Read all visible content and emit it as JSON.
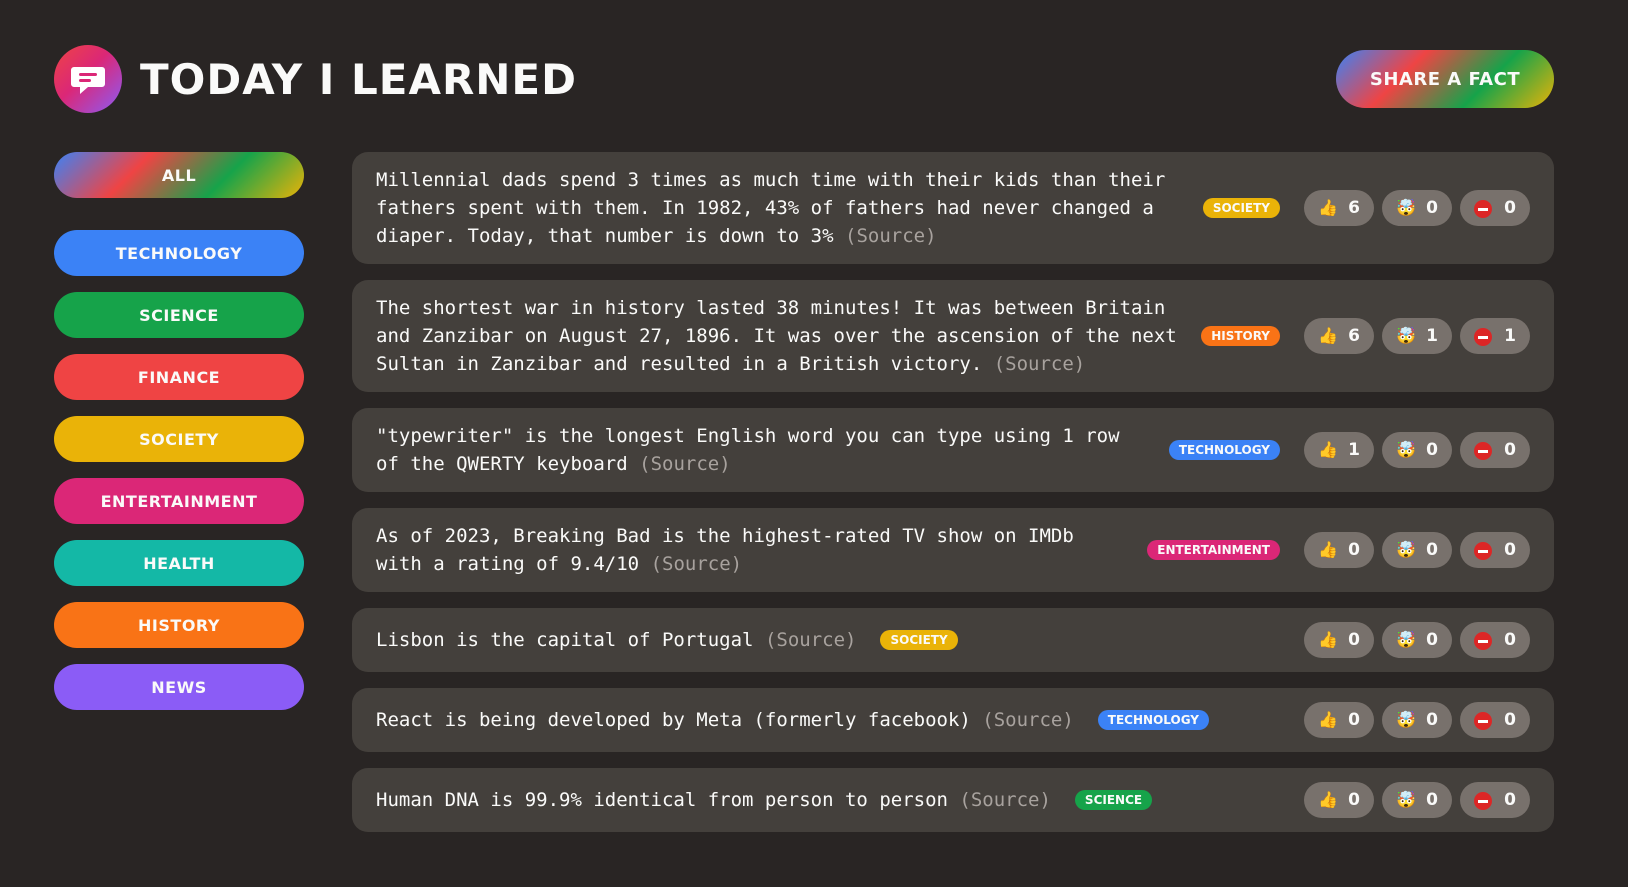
{
  "header": {
    "title": "Today I Learned",
    "share_label": "Share a fact",
    "logo_icon": "speech-bubble-icon"
  },
  "colors": {
    "technology": "#3b82f6",
    "science": "#16a34a",
    "finance": "#ef4444",
    "society": "#eab308",
    "entertainment": "#db2777",
    "health": "#14b8a6",
    "history": "#f97316",
    "news": "#8b5cf6"
  },
  "sidebar": {
    "all_label": "All",
    "categories": [
      {
        "key": "technology",
        "label": "Technology"
      },
      {
        "key": "science",
        "label": "Science"
      },
      {
        "key": "finance",
        "label": "Finance"
      },
      {
        "key": "society",
        "label": "Society"
      },
      {
        "key": "entertainment",
        "label": "Entertainment"
      },
      {
        "key": "health",
        "label": "Health"
      },
      {
        "key": "history",
        "label": "History"
      },
      {
        "key": "news",
        "label": "News"
      }
    ]
  },
  "facts": [
    {
      "text": "Millennial dads spend 3 times as much time with their kids than their fathers spent with them. In 1982, 43% of fathers had never changed a diaper. Today, that number is down to 3%",
      "source_label": "(Source)",
      "category": "society",
      "category_label": "society",
      "votes": {
        "interesting": "6",
        "mindblowing": "0",
        "false": "0"
      }
    },
    {
      "text": "The shortest war in history lasted 38 minutes! It was between Britain and Zanzibar on August 27, 1896. It was over the ascension of the next Sultan in Zanzibar and resulted in a British victory.",
      "source_label": "(Source)",
      "category": "history",
      "category_label": "history",
      "votes": {
        "interesting": "6",
        "mindblowing": "1",
        "false": "1"
      }
    },
    {
      "text": "\"typewriter\" is the longest English word you can type using 1 row of the QWERTY keyboard",
      "source_label": "(Source)",
      "category": "technology",
      "category_label": "technology",
      "votes": {
        "interesting": "1",
        "mindblowing": "0",
        "false": "0"
      }
    },
    {
      "text": "As of 2023, Breaking Bad is the highest-rated TV show on IMDb with a rating of 9.4/10",
      "source_label": "(Source)",
      "category": "entertainment",
      "category_label": "entertainment",
      "votes": {
        "interesting": "0",
        "mindblowing": "0",
        "false": "0"
      }
    },
    {
      "text": "Lisbon is the capital of Portugal",
      "source_label": "(Source)",
      "category": "society",
      "category_label": "society",
      "votes": {
        "interesting": "0",
        "mindblowing": "0",
        "false": "0"
      }
    },
    {
      "text": "React is being developed by Meta (formerly facebook)",
      "source_label": "(Source)",
      "category": "technology",
      "category_label": "technology",
      "votes": {
        "interesting": "0",
        "mindblowing": "0",
        "false": "0"
      }
    },
    {
      "text": "Human DNA is 99.9% identical from person to person",
      "source_label": "(Source)",
      "category": "science",
      "category_label": "science",
      "votes": {
        "interesting": "0",
        "mindblowing": "0",
        "false": "0"
      }
    }
  ]
}
